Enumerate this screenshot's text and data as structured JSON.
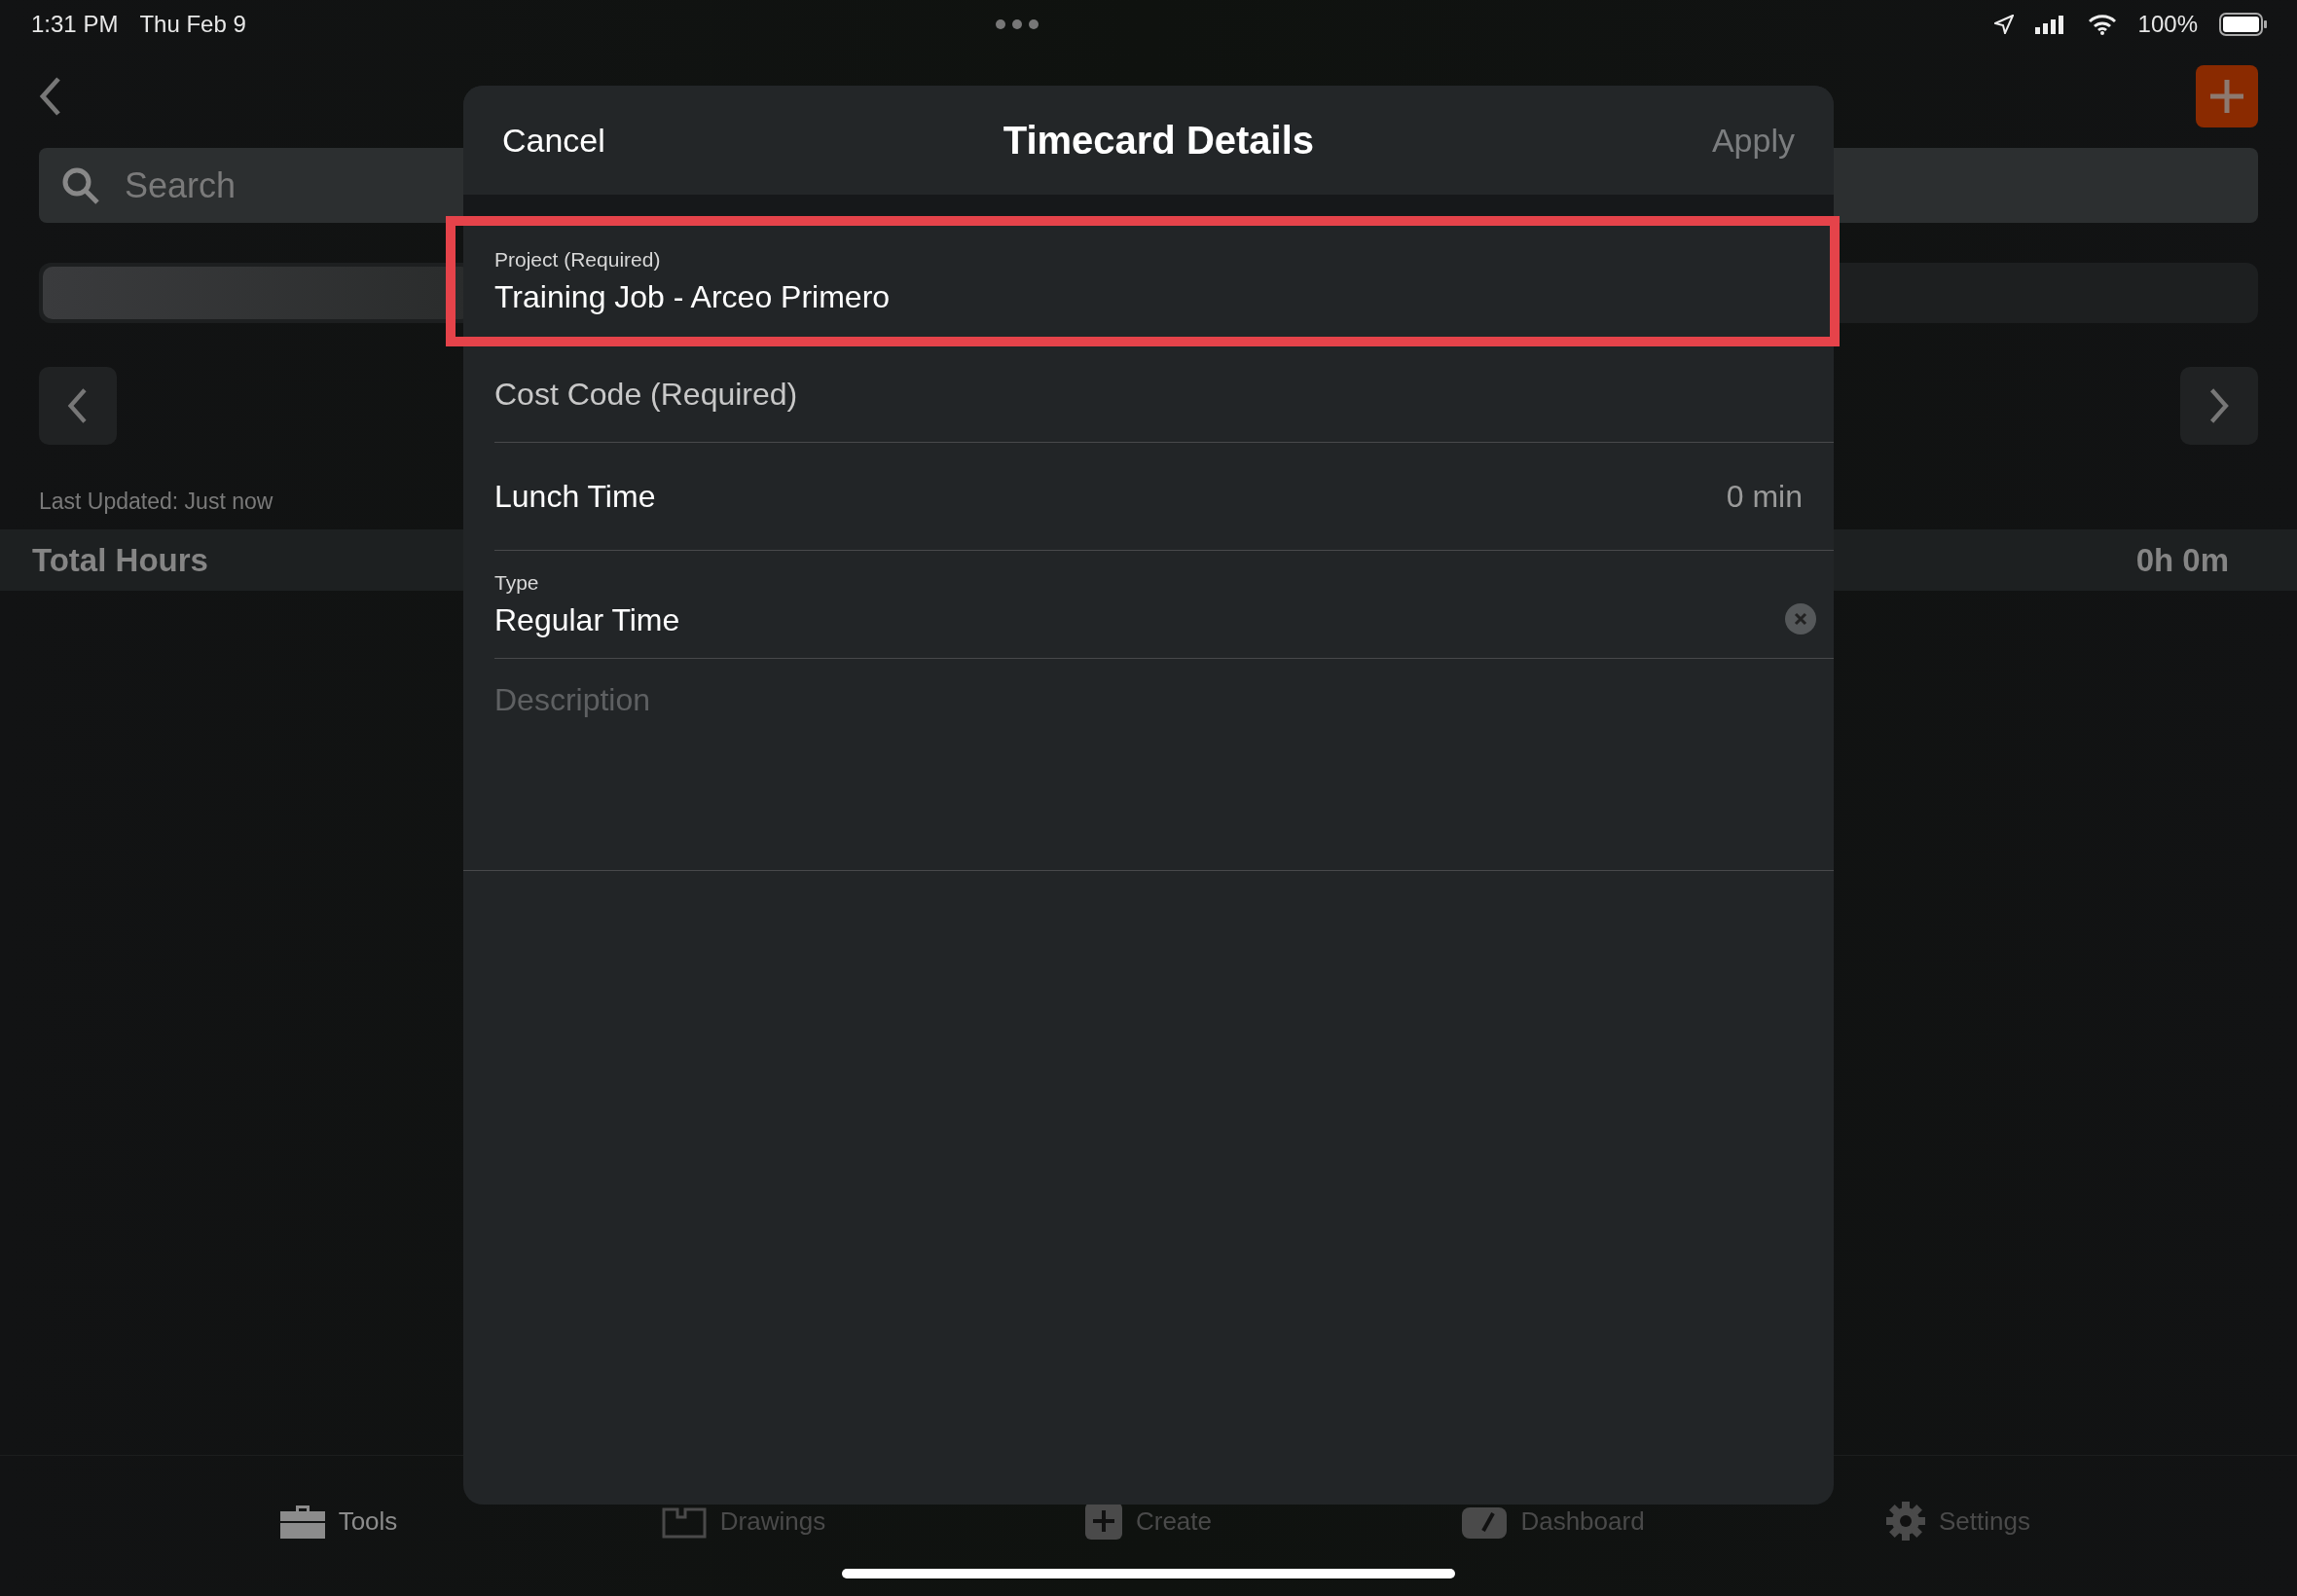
{
  "status_bar": {
    "time": "1:31 PM",
    "date": "Thu Feb 9",
    "battery": "100%"
  },
  "background": {
    "search": {
      "placeholder": "Search"
    },
    "last_updated": "Last Updated: Just now",
    "total": {
      "label": "Total Hours",
      "value": "0h 0m"
    }
  },
  "modal": {
    "cancel": "Cancel",
    "title": "Timecard Details",
    "apply": {
      "label": "Apply",
      "disabled": true
    },
    "fields": [
      {
        "kind": "stacked",
        "label": "Project (Required)",
        "value": "Training Job - Arceo Primero",
        "highlighted": true,
        "clearable": false
      },
      {
        "kind": "empty",
        "label": "Cost Code (Required)",
        "highlighted": false,
        "clearable": false
      },
      {
        "kind": "inline",
        "label": "Lunch Time",
        "value": "0 min",
        "highlighted": false,
        "clearable": false
      },
      {
        "kind": "stacked",
        "label": "Type",
        "value": "Regular Time",
        "highlighted": false,
        "clearable": true
      }
    ],
    "description": {
      "placeholder": "Description"
    }
  },
  "tab_bar": [
    {
      "label": "Tools",
      "selected": true
    },
    {
      "label": "Drawings",
      "selected": false
    },
    {
      "label": "Create",
      "selected": false
    },
    {
      "label": "Dashboard",
      "selected": false
    },
    {
      "label": "Settings",
      "selected": false
    }
  ]
}
